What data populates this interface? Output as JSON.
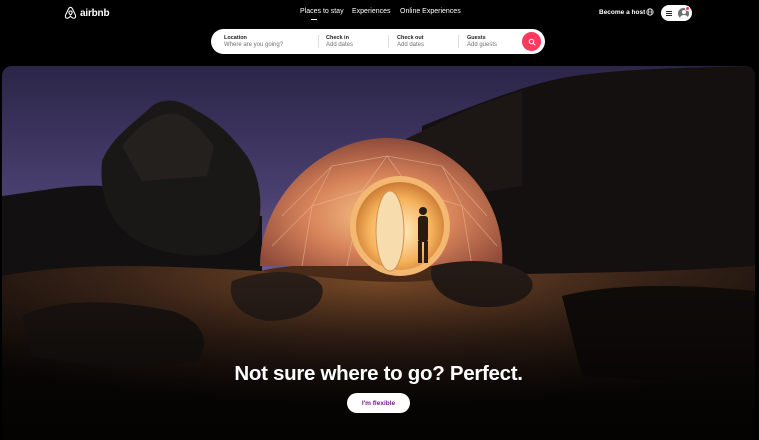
{
  "brand": {
    "name": "airbnb",
    "color": "#ff385c"
  },
  "nav": {
    "tabs": [
      {
        "label": "Places to stay",
        "active": true
      },
      {
        "label": "Experiences",
        "active": false
      },
      {
        "label": "Online Experiences",
        "active": false
      }
    ]
  },
  "header": {
    "become_host": "Become a host",
    "globe_icon": "globe-icon",
    "menu_icon": "hamburger-menu-icon",
    "avatar_icon": "user-avatar-icon"
  },
  "search": {
    "location": {
      "label": "Location",
      "placeholder": "Where are you going?"
    },
    "check_in": {
      "label": "Check in",
      "value": "Add dates"
    },
    "check_out": {
      "label": "Check out",
      "value": "Add dates"
    },
    "guests": {
      "label": "Guests",
      "value": "Add guests"
    },
    "button_icon": "search-icon"
  },
  "hero": {
    "title": "Not sure where to go? Perfect.",
    "button_label": "I'm flexible",
    "button_text_color": "#7b1a8f"
  }
}
